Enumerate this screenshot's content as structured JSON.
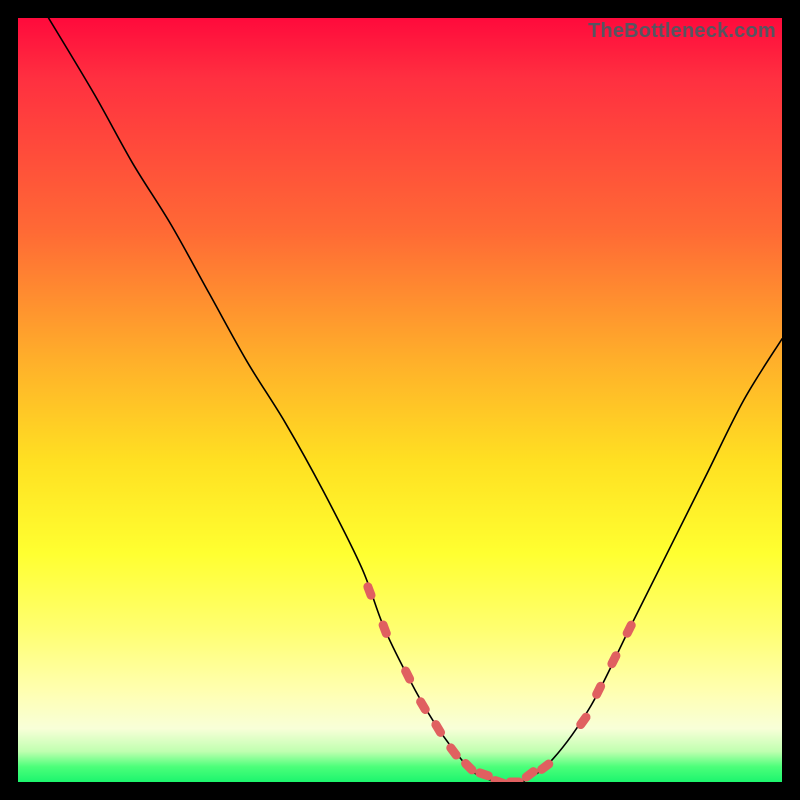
{
  "attribution": "TheBottleneck.com",
  "chart_data": {
    "type": "line",
    "title": "",
    "xlabel": "",
    "ylabel": "",
    "xlim": [
      0,
      100
    ],
    "ylim": [
      0,
      100
    ],
    "legend": false,
    "grid": false,
    "series": [
      {
        "name": "bottleneck-curve",
        "x": [
          4,
          10,
          15,
          20,
          25,
          30,
          35,
          40,
          45,
          48,
          52,
          55,
          58,
          60,
          63,
          66,
          70,
          75,
          80,
          85,
          90,
          95,
          100
        ],
        "values": [
          100,
          90,
          81,
          73,
          64,
          55,
          47,
          38,
          28,
          20,
          12,
          7,
          3,
          1,
          0,
          0,
          3,
          10,
          20,
          30,
          40,
          50,
          58
        ]
      }
    ],
    "markers": {
      "name": "highlight-points",
      "color": "#e06060",
      "points": [
        {
          "x": 46,
          "y": 25
        },
        {
          "x": 48,
          "y": 20
        },
        {
          "x": 51,
          "y": 14
        },
        {
          "x": 53,
          "y": 10
        },
        {
          "x": 55,
          "y": 7
        },
        {
          "x": 57,
          "y": 4
        },
        {
          "x": 59,
          "y": 2
        },
        {
          "x": 61,
          "y": 1
        },
        {
          "x": 63,
          "y": 0
        },
        {
          "x": 65,
          "y": 0
        },
        {
          "x": 67,
          "y": 1
        },
        {
          "x": 69,
          "y": 2
        },
        {
          "x": 74,
          "y": 8
        },
        {
          "x": 76,
          "y": 12
        },
        {
          "x": 78,
          "y": 16
        },
        {
          "x": 80,
          "y": 20
        }
      ]
    }
  }
}
